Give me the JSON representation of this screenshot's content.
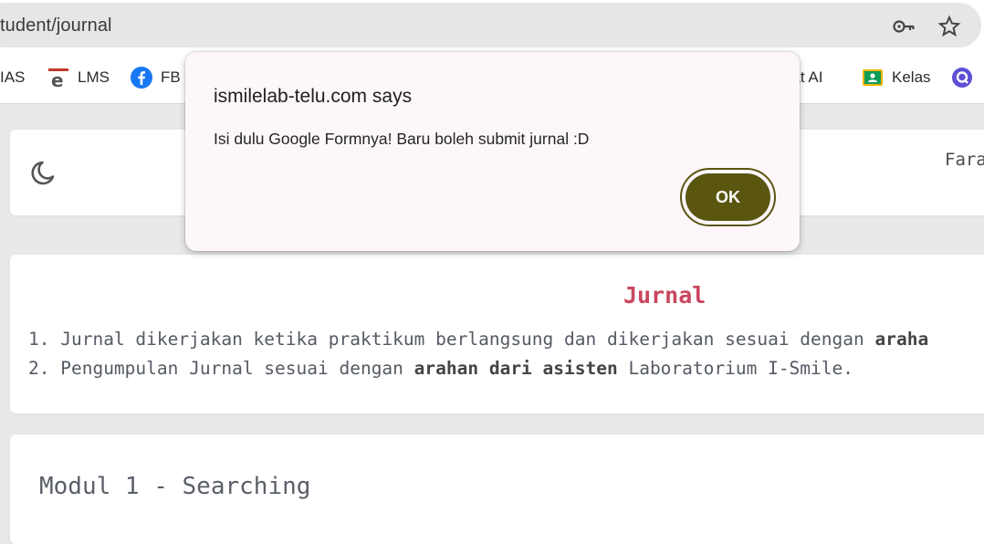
{
  "browser": {
    "url": "tudent/journal",
    "bookmarks": [
      {
        "label": "IAS",
        "icon": "bookmark-favicon"
      },
      {
        "label": "LMS",
        "icon": "lms-e-icon"
      },
      {
        "label": "FB",
        "icon": "facebook-icon"
      },
      {
        "label": "hat AI",
        "icon": ""
      },
      {
        "label": "Kelas",
        "icon": "google-classroom-icon"
      }
    ],
    "accent_colors": {
      "facebook": "#1877f2",
      "classroom": "#f4b400",
      "ok_button": "#5a5610"
    }
  },
  "header": {
    "user": "Fara"
  },
  "journal": {
    "title": "Jurnal",
    "rules": [
      {
        "num": "1.",
        "text": "Jurnal dikerjakan ketika praktikum berlangsung dan dikerjakan sesuai dengan ",
        "bold": "araha"
      },
      {
        "num": "2.",
        "text": "Pengumpulan Jurnal sesuai dengan ",
        "bold": "arahan dari asisten",
        "after": " Laboratorium I-Smile."
      }
    ]
  },
  "module": {
    "title": "Modul 1 - Searching"
  },
  "dialog": {
    "title": "ismilelab-telu.com says",
    "message": "Isi dulu Google Formnya! Baru boleh submit jurnal :D",
    "ok_label": "OK"
  }
}
